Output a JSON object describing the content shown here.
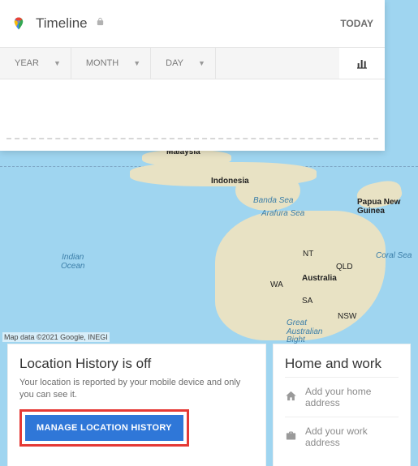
{
  "header": {
    "title": "Timeline",
    "today_label": "TODAY"
  },
  "filters": {
    "year": "YEAR",
    "month": "MONTH",
    "day": "DAY"
  },
  "map": {
    "attribution": "Map data ©2021 Google, INEGI",
    "labels": {
      "malaysia": "Malaysia",
      "indonesia": "Indonesia",
      "australia": "Australia",
      "png": "Papua New\nGuinea",
      "nt": "NT",
      "qld": "QLD",
      "wa": "WA",
      "sa": "SA",
      "nsw": "NSW",
      "indian_ocean": "Indian\nOcean",
      "banda_sea": "Banda Sea",
      "arafura_sea": "Arafura Sea",
      "coral_sea": "Coral Sea",
      "gab": "Great\nAustralian\nBight"
    }
  },
  "location_history": {
    "title": "Location History is off",
    "desc": "Your location is reported by your mobile device and only you can see it.",
    "button": "MANAGE LOCATION HISTORY"
  },
  "home_work": {
    "title": "Home and work",
    "home_placeholder": "Add your home address",
    "work_placeholder": "Add your work address"
  }
}
